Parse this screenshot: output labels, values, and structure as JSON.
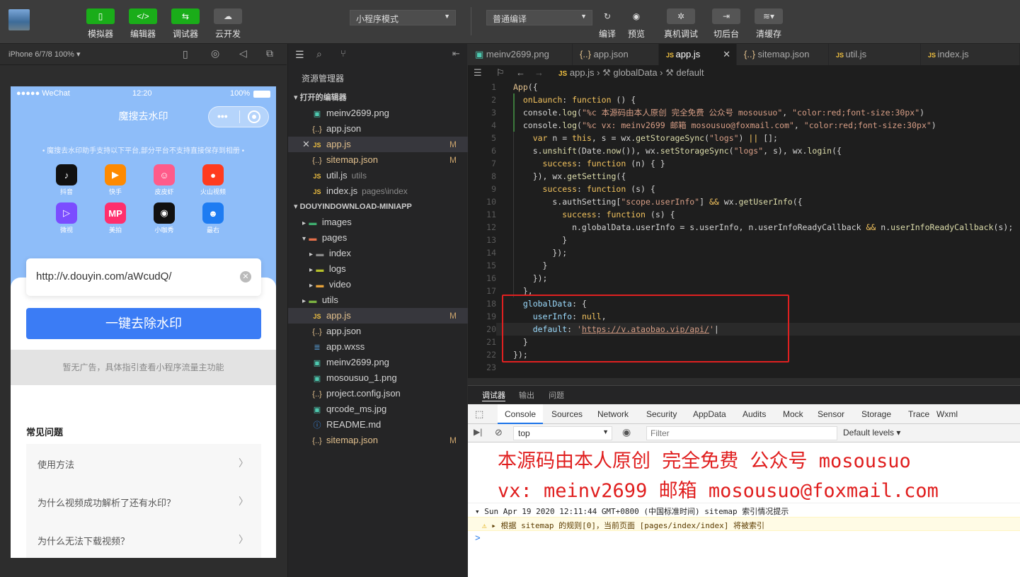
{
  "toolbar": {
    "buttons": [
      {
        "label": "模拟器",
        "icon": "phone-icon"
      },
      {
        "label": "编辑器",
        "icon": "code-icon"
      },
      {
        "label": "调试器",
        "icon": "debug-icon"
      },
      {
        "label": "云开发",
        "icon": "cloud-icon"
      }
    ],
    "mode_select": "小程序模式",
    "compile_select": "普通编译",
    "actions": [
      {
        "label": "编译",
        "icon": "refresh-icon"
      },
      {
        "label": "预览",
        "icon": "eye-icon"
      },
      {
        "label": "真机调试",
        "icon": "bug-icon"
      },
      {
        "label": "切后台",
        "icon": "switch-icon"
      },
      {
        "label": "清缓存",
        "icon": "layers-icon"
      }
    ]
  },
  "simulator": {
    "device": "iPhone 6/7/8 100%",
    "status_carrier": "●●●●● WeChat",
    "status_time": "12:20",
    "status_battery": "100%",
    "nav_title": "魔搜去水印",
    "hint": "• 魔搜去水印助手支持以下平台,部分平台不支持直接保存到相册 •",
    "apps": [
      {
        "name": "抖音",
        "glyph": "♪",
        "color": "#111111"
      },
      {
        "name": "快手",
        "glyph": "▶",
        "color": "#ff8a00"
      },
      {
        "name": "皮皮虾",
        "glyph": "☺",
        "color": "#ff5b8a"
      },
      {
        "name": "火山视频",
        "glyph": "●",
        "color": "#ff3b1f"
      },
      {
        "name": "微视",
        "glyph": "▷",
        "color": "#7b4dff"
      },
      {
        "name": "美拍",
        "glyph": "MP",
        "color": "#ff2f6d"
      },
      {
        "name": "小咖秀",
        "glyph": "◉",
        "color": "#111111"
      },
      {
        "name": "最右",
        "glyph": "☻",
        "color": "#1e7cf2"
      }
    ],
    "url_value": "http://v.douyin.com/aWcudQ/",
    "main_button": "一键去除水印",
    "ad_text": "暂无广告，具体指引查看小程序流量主功能",
    "faq_title": "常见问题",
    "faq": [
      "使用方法",
      "为什么视频成功解析了还有水印？",
      "为什么无法下载视频？"
    ]
  },
  "explorer": {
    "title": "资源管理器",
    "open_editors_header": "打开的编辑器",
    "open_editors": [
      {
        "name": "meinv2699.png",
        "type": "png",
        "sub": "",
        "mod": ""
      },
      {
        "name": "app.json",
        "type": "json",
        "sub": "",
        "mod": ""
      },
      {
        "name": "app.js",
        "type": "js",
        "sub": "",
        "mod": "M"
      },
      {
        "name": "sitemap.json",
        "type": "json",
        "sub": "",
        "mod": "M"
      },
      {
        "name": "util.js",
        "type": "js",
        "sub": "utils",
        "mod": ""
      },
      {
        "name": "index.js",
        "type": "js",
        "sub": "pages\\index",
        "mod": ""
      }
    ],
    "project_header": "DOUYINDOWNLOAD-MINIAPP",
    "tree": [
      {
        "name": "images",
        "type": "folder-img",
        "sub": "",
        "mod": ""
      },
      {
        "name": "pages",
        "type": "folder-open",
        "sub": "",
        "mod": ""
      },
      {
        "name": "index",
        "type": "folder",
        "sub": "",
        "mod": ""
      },
      {
        "name": "logs",
        "type": "folder-log",
        "sub": "",
        "mod": ""
      },
      {
        "name": "video",
        "type": "folder-vid",
        "sub": "",
        "mod": ""
      },
      {
        "name": "utils",
        "type": "folder-util",
        "sub": "",
        "mod": ""
      },
      {
        "name": "app.js",
        "type": "js",
        "sub": "",
        "mod": "M"
      },
      {
        "name": "app.json",
        "type": "json",
        "sub": "",
        "mod": ""
      },
      {
        "name": "app.wxss",
        "type": "css",
        "sub": "",
        "mod": ""
      },
      {
        "name": "meinv2699.png",
        "type": "png",
        "sub": "",
        "mod": ""
      },
      {
        "name": "mosousuo_1.png",
        "type": "png",
        "sub": "",
        "mod": ""
      },
      {
        "name": "project.config.json",
        "type": "json",
        "sub": "",
        "mod": ""
      },
      {
        "name": "qrcode_ms.jpg",
        "type": "png",
        "sub": "",
        "mod": ""
      },
      {
        "name": "README.md",
        "type": "info",
        "sub": "",
        "mod": ""
      },
      {
        "name": "sitemap.json",
        "type": "json",
        "sub": "",
        "mod": "M"
      }
    ]
  },
  "editor": {
    "tabs": [
      {
        "name": "meinv2699.png",
        "type": "png"
      },
      {
        "name": "app.json",
        "type": "json"
      },
      {
        "name": "app.js",
        "type": "js"
      },
      {
        "name": "sitemap.json",
        "type": "json"
      },
      {
        "name": "util.js",
        "type": "js"
      },
      {
        "name": "index.js",
        "type": "js"
      }
    ],
    "breadcrumb": [
      "app.js",
      "globalData",
      "default"
    ],
    "line_numbers": [
      "1",
      "2",
      "3",
      "4",
      "5",
      "6",
      "7",
      "8",
      "9",
      "10",
      "11",
      "12",
      "13",
      "14",
      "15",
      "16",
      "17",
      "18",
      "19",
      "20",
      "21",
      "22",
      "23"
    ]
  },
  "devtools": {
    "top_tabs": [
      "调试器",
      "输出",
      "问题"
    ],
    "console_tabs": [
      "Console",
      "Sources",
      "Network",
      "Security",
      "AppData",
      "Audits",
      "Mock",
      "Sensor",
      "Storage",
      "Trace",
      "Wxml"
    ],
    "context": "top",
    "filter_placeholder": "Filter",
    "levels": "Default levels",
    "big_line_1": "本源码由本人原创 完全免费 公众号 mosousuo",
    "big_line_2": "vx: meinv2699 邮箱 mosousuo@foxmail.com",
    "log_date": "Sun Apr 19 2020 12:11:44 GMT+0800 (中国标准时间) sitemap 索引情况提示",
    "log_warn": "根据 sitemap 的规则[0]，当前页面 [pages/index/index] 将被索引",
    "prompt": ">"
  },
  "colors": {
    "accent_green": "#1aad19",
    "primary_blue": "#3b7cf5",
    "highlight_red": "#e01e1e"
  }
}
